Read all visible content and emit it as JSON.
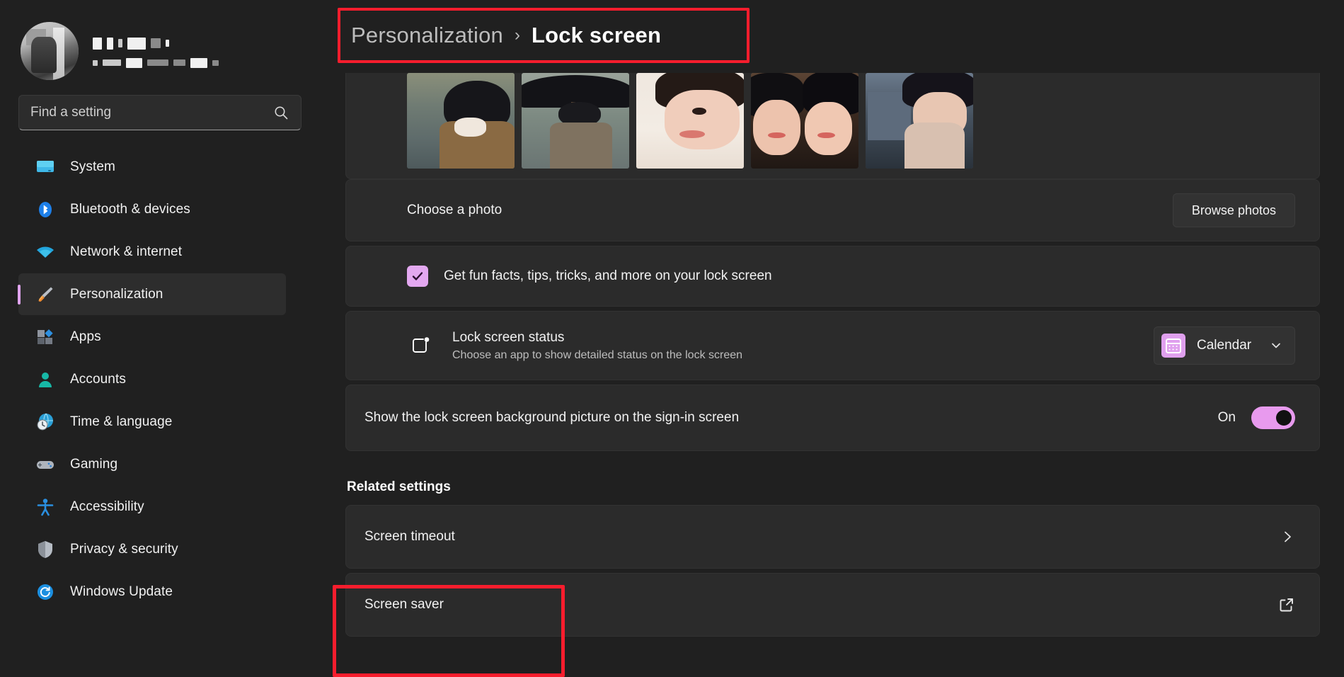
{
  "sidebar": {
    "profile": {
      "avatar": "user-avatar-photo",
      "name_redacted": true,
      "detail_redacted": true
    },
    "search": {
      "placeholder": "Find a setting",
      "value": "",
      "icon": "search-icon"
    },
    "items": [
      {
        "label": "System",
        "icon": "system-monitor-icon",
        "active": false
      },
      {
        "label": "Bluetooth & devices",
        "icon": "bluetooth-icon",
        "active": false
      },
      {
        "label": "Network & internet",
        "icon": "wifi-icon",
        "active": false
      },
      {
        "label": "Personalization",
        "icon": "paintbrush-icon",
        "active": true
      },
      {
        "label": "Apps",
        "icon": "apps-grid-icon",
        "active": false
      },
      {
        "label": "Accounts",
        "icon": "person-icon",
        "active": false
      },
      {
        "label": "Time & language",
        "icon": "clock-globe-icon",
        "active": false
      },
      {
        "label": "Gaming",
        "icon": "gamepad-icon",
        "active": false
      },
      {
        "label": "Accessibility",
        "icon": "accessibility-person-icon",
        "active": false
      },
      {
        "label": "Privacy & security",
        "icon": "shield-icon",
        "active": false
      },
      {
        "label": "Windows Update",
        "icon": "refresh-circle-icon",
        "active": false
      }
    ]
  },
  "breadcrumb": {
    "parent": "Personalization",
    "separator": "›",
    "current": "Lock screen"
  },
  "main": {
    "thumbnails": {
      "count": 5,
      "selected_index": 0
    },
    "choose_photo": {
      "label": "Choose a photo",
      "button_label": "Browse photos"
    },
    "fun_facts": {
      "label": "Get fun facts, tips, tricks, and more on your lock screen",
      "checked": true
    },
    "lock_screen_status": {
      "title": "Lock screen status",
      "subtitle": "Choose an app to show detailed status on the lock screen",
      "icon": "lock-screen-status-icon",
      "dropdown_value": "Calendar",
      "dropdown_icon": "calendar-icon",
      "chevron": "chevron-down-icon"
    },
    "signin_background": {
      "label": "Show the lock screen background picture on the sign-in screen",
      "state_label": "On",
      "checked": true
    },
    "related_settings": {
      "heading": "Related settings",
      "rows": [
        {
          "label": "Screen timeout",
          "trailing_icon": "chevron-right-icon"
        },
        {
          "label": "Screen saver",
          "trailing_icon": "external-link-icon"
        }
      ]
    }
  },
  "annotations": {
    "color": "#f81d2d",
    "boxes": [
      {
        "target": "breadcrumb"
      },
      {
        "target": "screen-saver-row"
      }
    ]
  },
  "theme": {
    "background": "#202020",
    "card": "#2b2b2b",
    "accent": "#e0a4ee",
    "toggle_on": "#e89aee",
    "annotation": "#f81d2d"
  }
}
